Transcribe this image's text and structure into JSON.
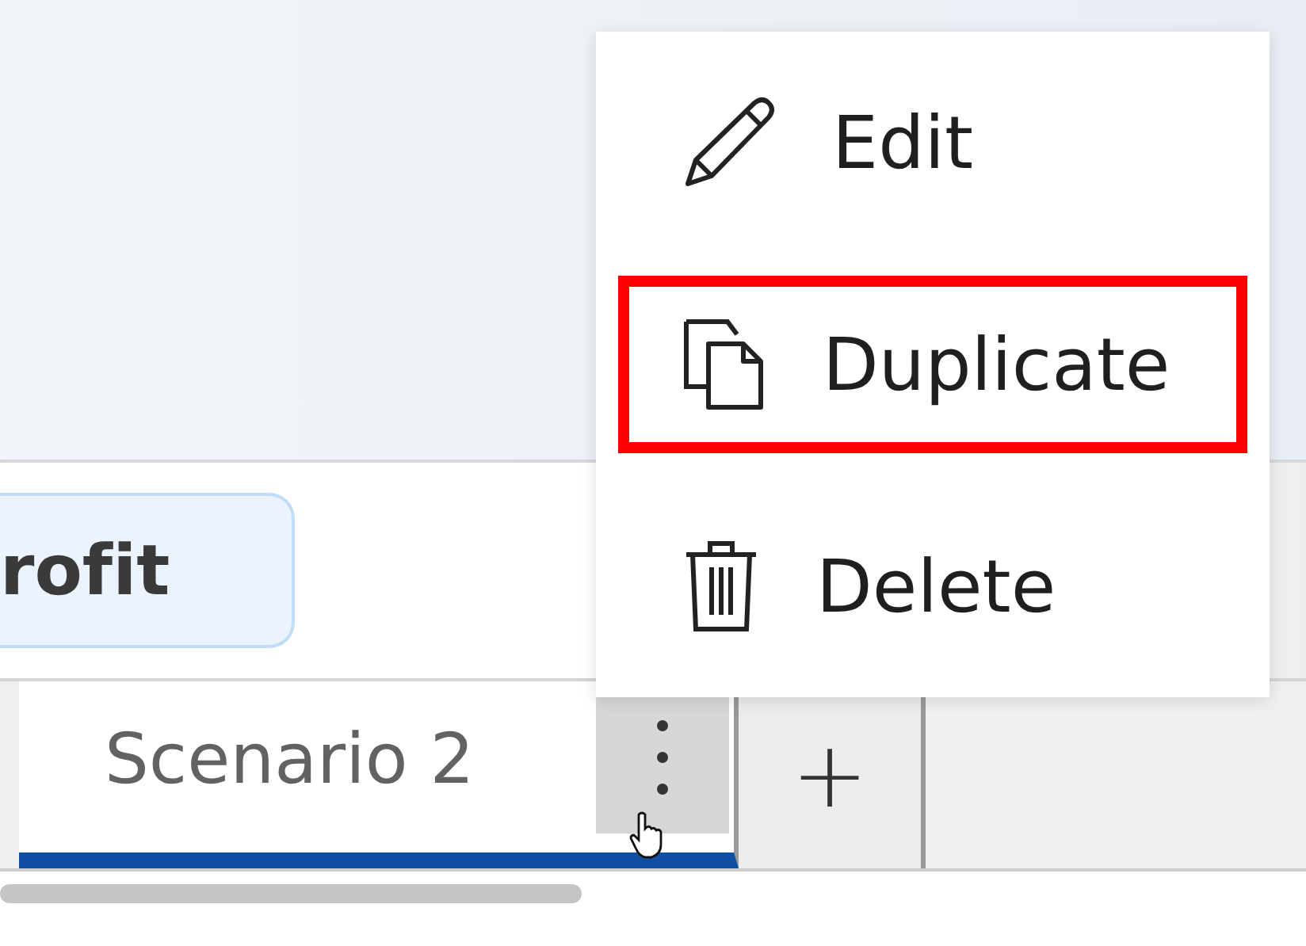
{
  "filter_chip": {
    "label": "rofit"
  },
  "tabs": [
    {
      "label": "Scenario 2",
      "selected": true
    }
  ],
  "add_tab": {
    "label": "+"
  },
  "context_menu": {
    "items": [
      {
        "label": "Edit",
        "kind": "edit",
        "highlighted": false
      },
      {
        "label": "Duplicate",
        "kind": "duplicate",
        "highlighted": true
      },
      {
        "label": "Delete",
        "kind": "delete",
        "highlighted": false
      }
    ]
  }
}
